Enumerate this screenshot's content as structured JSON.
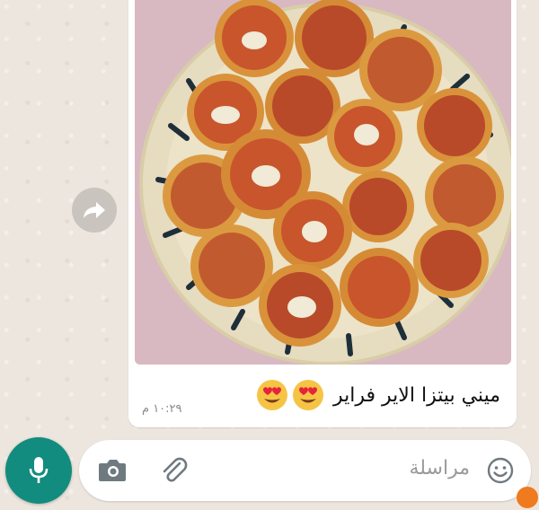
{
  "message": {
    "caption": "ميني بيتزا الاير فراير",
    "emojis": [
      "smiling-face-heart-eyes",
      "smiling-face-heart-eyes"
    ],
    "time": "١٠:٢٩ م"
  },
  "composer": {
    "placeholder": "مراسلة"
  },
  "icons": {
    "forward": "forward-arrow-icon",
    "mic": "mic-icon",
    "camera": "camera-icon",
    "attach": "paperclip-icon",
    "emoji": "emoji-icon"
  },
  "colors": {
    "accent": "#128c7e",
    "bubble": "#ffffff",
    "background": "#ece5dd"
  }
}
